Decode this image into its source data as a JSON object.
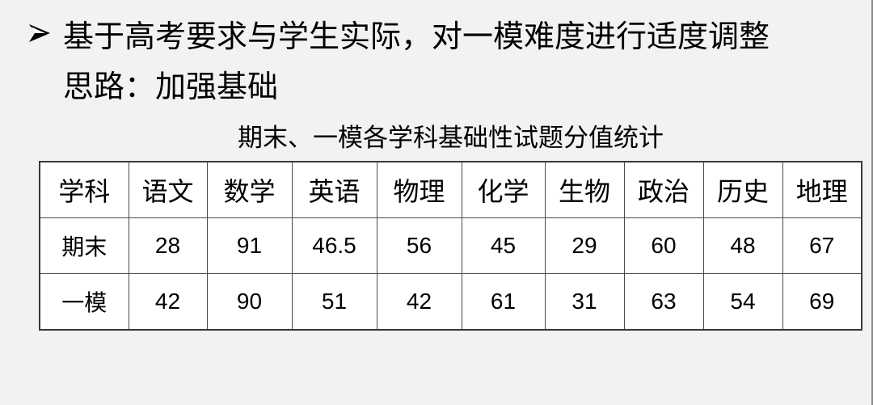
{
  "slide": {
    "bullet_icon": "arrowhead-bullet-icon",
    "heading": "基于高考要求与学生实际，对一模难度进行适度调整",
    "subheading": "思路：加强基础",
    "table_caption": "期末、一模各学科基础性试题分值统计"
  },
  "table": {
    "header_label": "学科",
    "subjects": [
      "语文",
      "数学",
      "英语",
      "物理",
      "化学",
      "生物",
      "政治",
      "历史",
      "地理"
    ],
    "rows": [
      {
        "label": "期末",
        "values": [
          "28",
          "91",
          "46.5",
          "56",
          "45",
          "29",
          "60",
          "48",
          "67"
        ]
      },
      {
        "label": "一模",
        "values": [
          "42",
          "90",
          "51",
          "42",
          "61",
          "31",
          "63",
          "54",
          "69"
        ]
      }
    ]
  }
}
